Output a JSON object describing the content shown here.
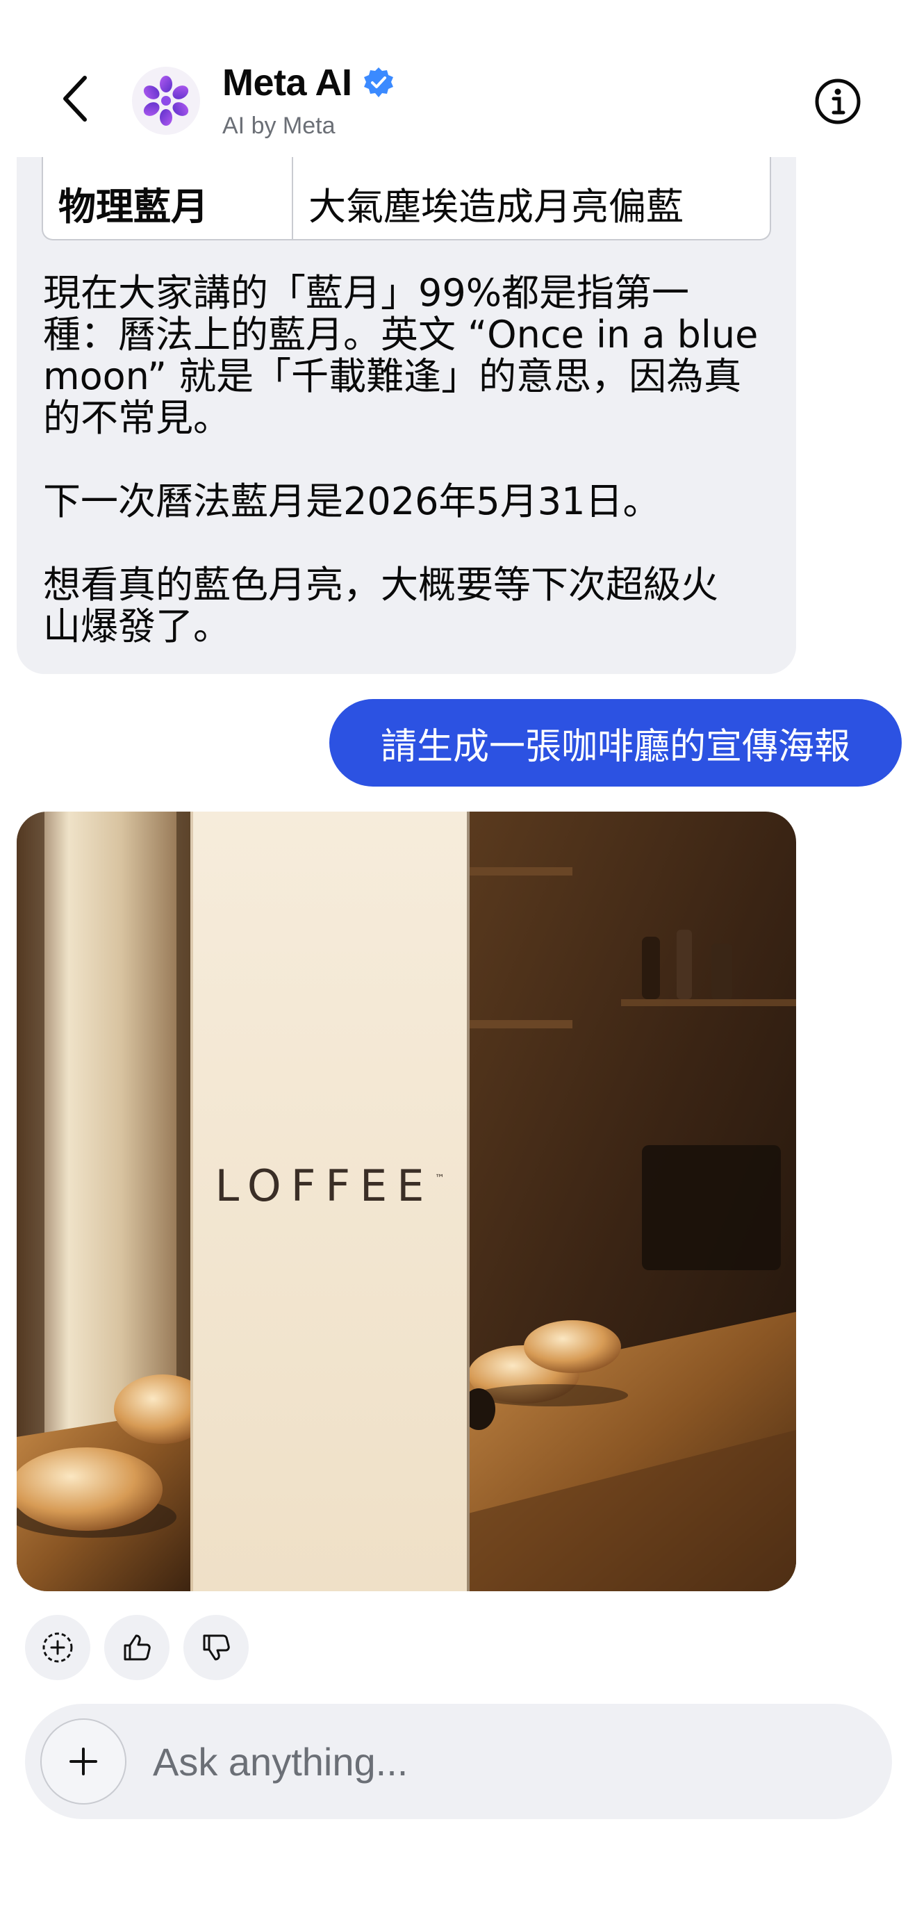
{
  "header": {
    "title": "Meta AI",
    "subtitle": "AI by Meta",
    "back_icon": "chevron-left-icon",
    "info_icon": "info-icon",
    "verified_color": "#3b8aff"
  },
  "conversation": {
    "ai_message": {
      "table_row": [
        "物理藍月",
        "大氣塵埃造成月亮偏藍"
      ],
      "paragraph_1": "現在大家講的「藍月」99%都是指第一\n種：曆法上的藍月。英文 “Once in a blue\nmoon” 就是「千載難逢」的意思，因為真\n的不常見。",
      "paragraph_2": "下一次曆法藍月是2026年5月31日。",
      "paragraph_3": "想看真的藍色月亮，大概要等下次超級火\n山爆發了。"
    },
    "user_message": "請生成一張咖啡廳的宣傳海報",
    "generated_image": {
      "poster_text": "LOFFEE",
      "trademark": "™"
    }
  },
  "reactions": [
    "add-reaction-icon",
    "thumbs-up-icon",
    "thumbs-down-icon"
  ],
  "composer": {
    "placeholder": "Ask anything..."
  },
  "colors": {
    "user_bubble": "#2c52e2",
    "ai_bubble": "#eff0f4"
  }
}
